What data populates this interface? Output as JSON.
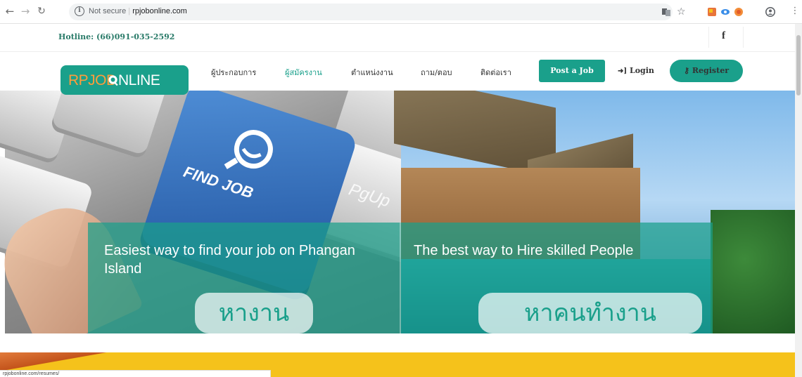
{
  "browser": {
    "security_label": "Not secure",
    "url": "rpjobonline.com",
    "status_url": "rpjobonline.com/resumes/"
  },
  "topbar": {
    "hotline": "Hotline: (66)091-035-2592",
    "social_icon": "f"
  },
  "logo": {
    "part1": "RPJOB",
    "part2": "NLINE"
  },
  "menu": [
    {
      "label": "ผู้ประกอบการ"
    },
    {
      "label": "ผู้สมัครงาน"
    },
    {
      "label": "ตำแหน่งงาน"
    },
    {
      "label": "ถาม/ตอบ"
    },
    {
      "label": "ติดต่อเรา"
    }
  ],
  "actions": {
    "post_job": "Post a Job",
    "login": "Login",
    "register": "Register"
  },
  "hero": {
    "left_heading": "Easiest way to find your job on Phangan Island",
    "left_cta": "หางาน",
    "right_heading": "The best way to Hire skilled People",
    "right_cta": "หาคนทำงาน",
    "key_label": "FIND JOB",
    "key_label2": "PgUp"
  },
  "colors": {
    "brand": "#1aa08b",
    "accent": "#ff9c3b",
    "banner": "#f5c21b"
  }
}
